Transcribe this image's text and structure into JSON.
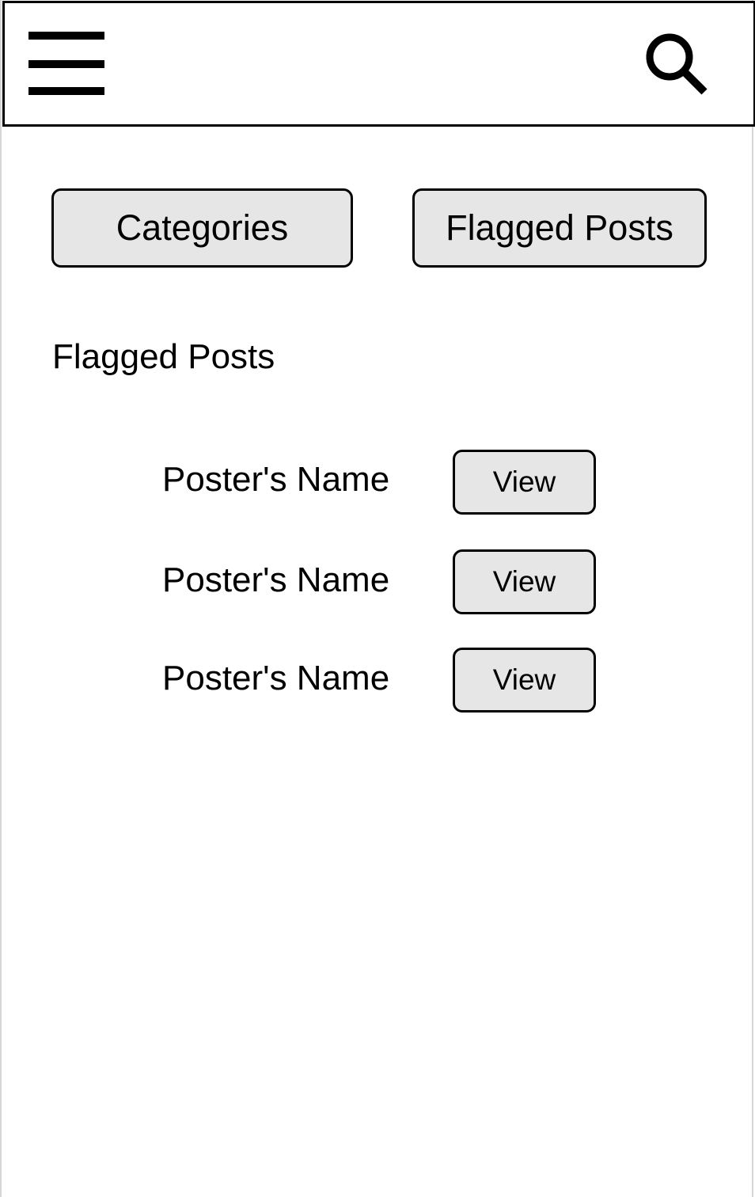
{
  "header": {
    "menu_icon": "hamburger-menu-icon",
    "search_icon": "search-icon"
  },
  "tabs": {
    "categories_label": "Categories",
    "flagged_posts_label": "Flagged Posts"
  },
  "main": {
    "section_title": "Flagged Posts",
    "posts": [
      {
        "poster_name": "Poster's Name",
        "action_label": "View"
      },
      {
        "poster_name": "Poster's Name",
        "action_label": "View"
      },
      {
        "poster_name": "Poster's Name",
        "action_label": "View"
      }
    ]
  },
  "colors": {
    "button_fill": "#e6e6e6",
    "border": "#000000",
    "background": "#ffffff"
  }
}
